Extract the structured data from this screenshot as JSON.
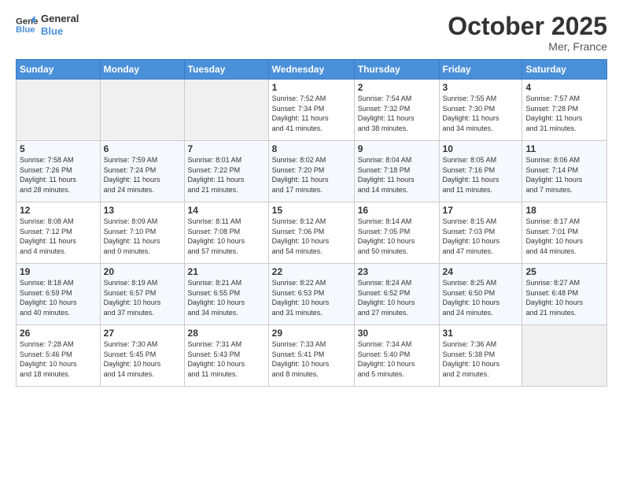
{
  "header": {
    "logo_general": "General",
    "logo_blue": "Blue",
    "month": "October 2025",
    "location": "Mer, France"
  },
  "days_of_week": [
    "Sunday",
    "Monday",
    "Tuesday",
    "Wednesday",
    "Thursday",
    "Friday",
    "Saturday"
  ],
  "weeks": [
    [
      {
        "day": "",
        "info": ""
      },
      {
        "day": "",
        "info": ""
      },
      {
        "day": "",
        "info": ""
      },
      {
        "day": "1",
        "info": "Sunrise: 7:52 AM\nSunset: 7:34 PM\nDaylight: 11 hours\nand 41 minutes."
      },
      {
        "day": "2",
        "info": "Sunrise: 7:54 AM\nSunset: 7:32 PM\nDaylight: 11 hours\nand 38 minutes."
      },
      {
        "day": "3",
        "info": "Sunrise: 7:55 AM\nSunset: 7:30 PM\nDaylight: 11 hours\nand 34 minutes."
      },
      {
        "day": "4",
        "info": "Sunrise: 7:57 AM\nSunset: 7:28 PM\nDaylight: 11 hours\nand 31 minutes."
      }
    ],
    [
      {
        "day": "5",
        "info": "Sunrise: 7:58 AM\nSunset: 7:26 PM\nDaylight: 11 hours\nand 28 minutes."
      },
      {
        "day": "6",
        "info": "Sunrise: 7:59 AM\nSunset: 7:24 PM\nDaylight: 11 hours\nand 24 minutes."
      },
      {
        "day": "7",
        "info": "Sunrise: 8:01 AM\nSunset: 7:22 PM\nDaylight: 11 hours\nand 21 minutes."
      },
      {
        "day": "8",
        "info": "Sunrise: 8:02 AM\nSunset: 7:20 PM\nDaylight: 11 hours\nand 17 minutes."
      },
      {
        "day": "9",
        "info": "Sunrise: 8:04 AM\nSunset: 7:18 PM\nDaylight: 11 hours\nand 14 minutes."
      },
      {
        "day": "10",
        "info": "Sunrise: 8:05 AM\nSunset: 7:16 PM\nDaylight: 11 hours\nand 11 minutes."
      },
      {
        "day": "11",
        "info": "Sunrise: 8:06 AM\nSunset: 7:14 PM\nDaylight: 11 hours\nand 7 minutes."
      }
    ],
    [
      {
        "day": "12",
        "info": "Sunrise: 8:08 AM\nSunset: 7:12 PM\nDaylight: 11 hours\nand 4 minutes."
      },
      {
        "day": "13",
        "info": "Sunrise: 8:09 AM\nSunset: 7:10 PM\nDaylight: 11 hours\nand 0 minutes."
      },
      {
        "day": "14",
        "info": "Sunrise: 8:11 AM\nSunset: 7:08 PM\nDaylight: 10 hours\nand 57 minutes."
      },
      {
        "day": "15",
        "info": "Sunrise: 8:12 AM\nSunset: 7:06 PM\nDaylight: 10 hours\nand 54 minutes."
      },
      {
        "day": "16",
        "info": "Sunrise: 8:14 AM\nSunset: 7:05 PM\nDaylight: 10 hours\nand 50 minutes."
      },
      {
        "day": "17",
        "info": "Sunrise: 8:15 AM\nSunset: 7:03 PM\nDaylight: 10 hours\nand 47 minutes."
      },
      {
        "day": "18",
        "info": "Sunrise: 8:17 AM\nSunset: 7:01 PM\nDaylight: 10 hours\nand 44 minutes."
      }
    ],
    [
      {
        "day": "19",
        "info": "Sunrise: 8:18 AM\nSunset: 6:59 PM\nDaylight: 10 hours\nand 40 minutes."
      },
      {
        "day": "20",
        "info": "Sunrise: 8:19 AM\nSunset: 6:57 PM\nDaylight: 10 hours\nand 37 minutes."
      },
      {
        "day": "21",
        "info": "Sunrise: 8:21 AM\nSunset: 6:55 PM\nDaylight: 10 hours\nand 34 minutes."
      },
      {
        "day": "22",
        "info": "Sunrise: 8:22 AM\nSunset: 6:53 PM\nDaylight: 10 hours\nand 31 minutes."
      },
      {
        "day": "23",
        "info": "Sunrise: 8:24 AM\nSunset: 6:52 PM\nDaylight: 10 hours\nand 27 minutes."
      },
      {
        "day": "24",
        "info": "Sunrise: 8:25 AM\nSunset: 6:50 PM\nDaylight: 10 hours\nand 24 minutes."
      },
      {
        "day": "25",
        "info": "Sunrise: 8:27 AM\nSunset: 6:48 PM\nDaylight: 10 hours\nand 21 minutes."
      }
    ],
    [
      {
        "day": "26",
        "info": "Sunrise: 7:28 AM\nSunset: 5:46 PM\nDaylight: 10 hours\nand 18 minutes."
      },
      {
        "day": "27",
        "info": "Sunrise: 7:30 AM\nSunset: 5:45 PM\nDaylight: 10 hours\nand 14 minutes."
      },
      {
        "day": "28",
        "info": "Sunrise: 7:31 AM\nSunset: 5:43 PM\nDaylight: 10 hours\nand 11 minutes."
      },
      {
        "day": "29",
        "info": "Sunrise: 7:33 AM\nSunset: 5:41 PM\nDaylight: 10 hours\nand 8 minutes."
      },
      {
        "day": "30",
        "info": "Sunrise: 7:34 AM\nSunset: 5:40 PM\nDaylight: 10 hours\nand 5 minutes."
      },
      {
        "day": "31",
        "info": "Sunrise: 7:36 AM\nSunset: 5:38 PM\nDaylight: 10 hours\nand 2 minutes."
      },
      {
        "day": "",
        "info": ""
      }
    ]
  ]
}
